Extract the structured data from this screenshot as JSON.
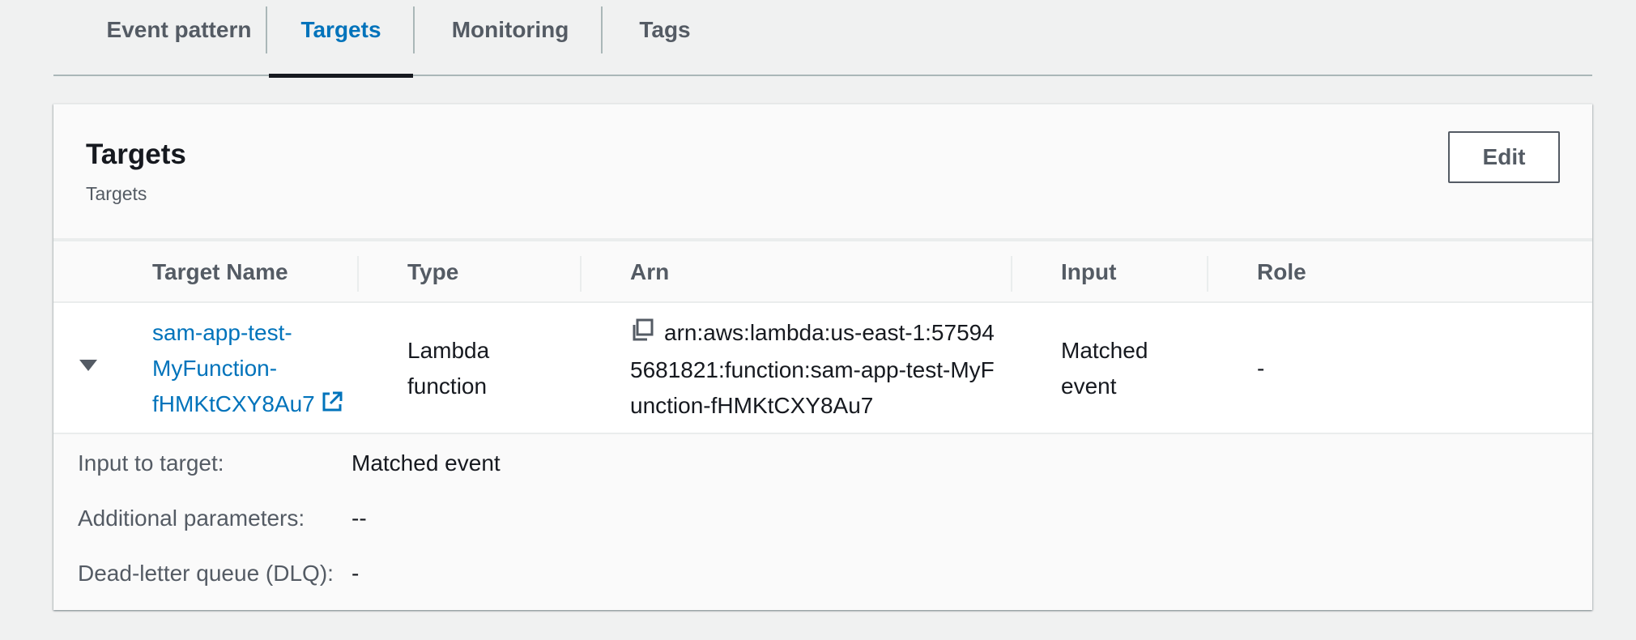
{
  "tabs": [
    {
      "label": "Event pattern"
    },
    {
      "label": "Targets"
    },
    {
      "label": "Monitoring"
    },
    {
      "label": "Tags"
    }
  ],
  "panel": {
    "title": "Targets",
    "subtitle": "Targets",
    "edit_label": "Edit"
  },
  "table": {
    "columns": [
      "Target Name",
      "Type",
      "Arn",
      "Input",
      "Role"
    ],
    "rows": [
      {
        "name_lines": [
          "sam-app-test-",
          "MyFunction-",
          "fHMKtCXY8Au7"
        ],
        "type_lines": [
          "Lambda",
          "function"
        ],
        "arn_lines": [
          "arn:aws:lambda:us-east-1:57594",
          "5681821:function:sam-app-test-MyF",
          "unction-fHMKtCXY8Au7"
        ],
        "input_lines": [
          "Matched",
          "event"
        ],
        "role": "-"
      }
    ]
  },
  "details": {
    "input_label": "Input to target:",
    "input_value": "Matched event",
    "params_label": "Additional parameters:",
    "params_value": "--",
    "dlq_label": "Dead-letter queue (DLQ):",
    "dlq_value": "-"
  }
}
